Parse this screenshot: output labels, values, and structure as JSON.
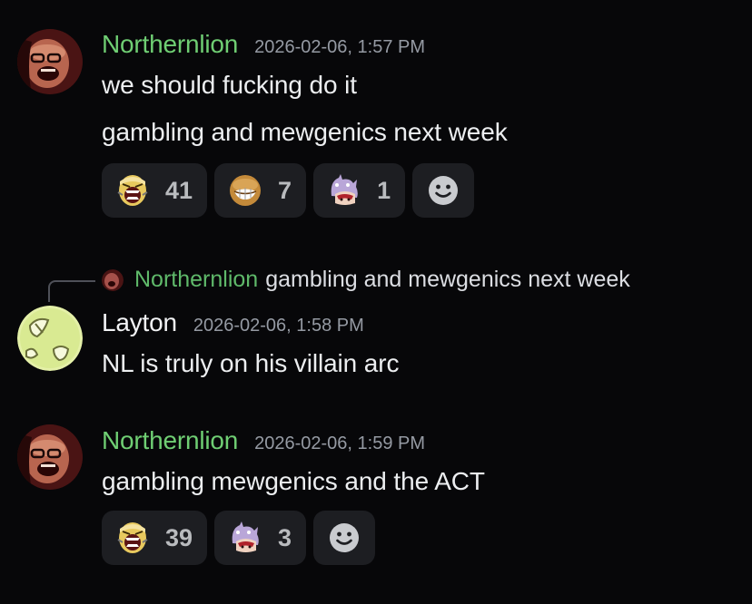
{
  "messages": [
    {
      "author": "Northernlion",
      "timestamp": "2026-02-06, 1:57 PM",
      "lines": [
        "we should fucking do it",
        "gambling and mewgenics next week"
      ],
      "reactions": [
        {
          "emoji": "screaming-face-emoji",
          "count": "41"
        },
        {
          "emoji": "grimace-face-emoji",
          "count": "7"
        },
        {
          "emoji": "anime-cat-emoji",
          "count": "1"
        }
      ]
    },
    {
      "reply": {
        "author": "Northernlion",
        "text": "gambling and mewgenics next week"
      },
      "author": "Layton",
      "timestamp": "2026-02-06, 1:58 PM",
      "lines": [
        "NL is truly on his villain arc"
      ]
    },
    {
      "author": "Northernlion",
      "timestamp": "2026-02-06, 1:59 PM",
      "lines": [
        "gambling mewgenics and the ACT"
      ],
      "reactions": [
        {
          "emoji": "screaming-face-emoji",
          "count": "39"
        },
        {
          "emoji": "anime-cat-emoji",
          "count": "3"
        }
      ]
    }
  ],
  "colors": {
    "background": "#070709",
    "northernlion_name": "#6fce73",
    "reaction_bg": "#1d1e22",
    "timestamp": "#959aa3"
  },
  "icons": {
    "add_reaction": "smiley-add-reaction-icon"
  }
}
